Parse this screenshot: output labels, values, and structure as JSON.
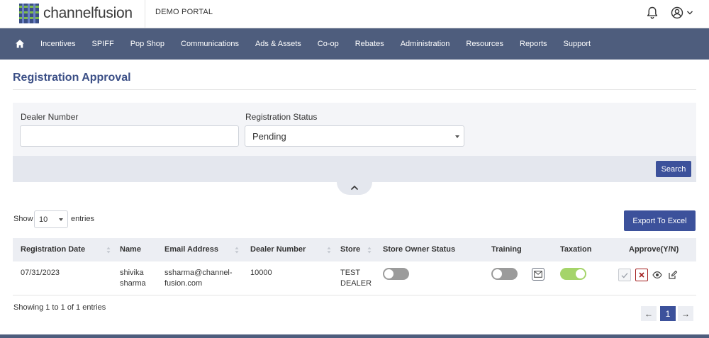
{
  "header": {
    "logo_text": "channelfusion",
    "portal_name": "DEMO PORTAL"
  },
  "nav": {
    "items": [
      "Incentives",
      "SPIFF",
      "Pop Shop",
      "Communications",
      "Ads & Assets",
      "Co-op",
      "Rebates",
      "Administration",
      "Resources",
      "Reports",
      "Support"
    ]
  },
  "page": {
    "title": "Registration Approval"
  },
  "filters": {
    "dealer_number_label": "Dealer Number",
    "dealer_number_value": "",
    "registration_status_label": "Registration Status",
    "registration_status_value": "Pending",
    "search_label": "Search"
  },
  "table_controls": {
    "show_label": "Show",
    "entries_value": "10",
    "entries_label": "entries",
    "export_label": "Export To Excel"
  },
  "table": {
    "columns": [
      "Registration Date",
      "Name",
      "Email Address",
      "Dealer Number",
      "Store",
      "Store Owner Status",
      "Training",
      "Taxation",
      "Approve(Y/N)"
    ],
    "rows": [
      {
        "registration_date": "07/31/2023",
        "name_line1": "shivika",
        "name_line2": "sharma",
        "email_line1": "ssharma@channel-",
        "email_line2": "fusion.com",
        "dealer_number": "10000",
        "store_line1": "TEST",
        "store_line2": "DEALER",
        "store_owner_status": false,
        "training": false,
        "taxation": true
      }
    ]
  },
  "pagination": {
    "summary": "Showing 1 to 1 of 1 entries",
    "prev": "←",
    "current": "1",
    "next": "→"
  },
  "colors": {
    "nav_bg": "#4e5d7d",
    "primary": "#3c519b",
    "toggle_off": "#9b9b9b",
    "toggle_on": "#a5d46a",
    "reject": "#a11d1d"
  }
}
